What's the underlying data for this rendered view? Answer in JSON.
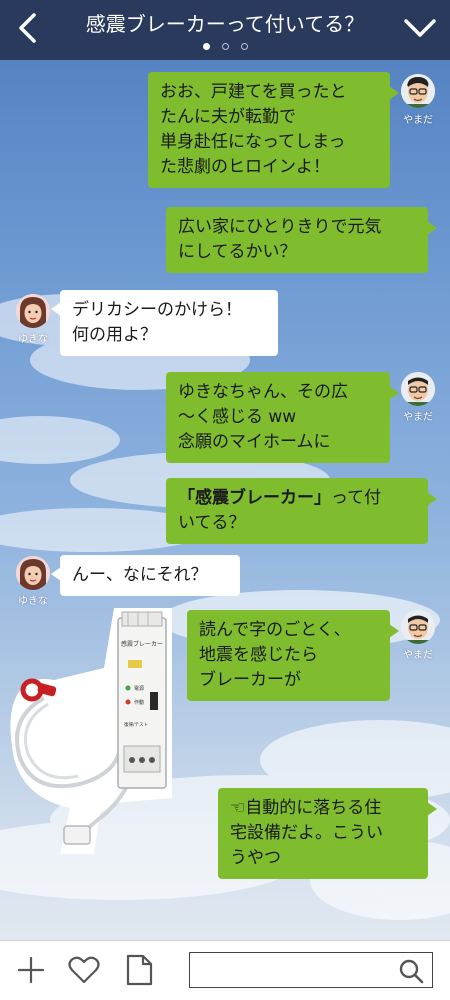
{
  "header": {
    "title": "感震ブレーカーって付いてる？",
    "page_dots": 3,
    "active_dot": 1
  },
  "users": {
    "yamada": {
      "name": "やまだ"
    },
    "yukina": {
      "name": "ゆきな"
    }
  },
  "messages": [
    {
      "from": "yamada",
      "side": "right",
      "lines": [
        "おお、戸建てを買ったと",
        "たんに夫が転勤で",
        "単身赴任になってしまっ",
        "た悲劇のヒロインよ！"
      ]
    },
    {
      "from": "yamada",
      "side": "right",
      "lines": [
        "広い家にひとりきりで元気",
        "にしてるかい？"
      ]
    },
    {
      "from": "yukina",
      "side": "left",
      "lines": [
        "デリカシーのかけら！",
        "何の用よ？"
      ]
    },
    {
      "from": "yamada",
      "side": "right",
      "lines": [
        "ゆきなちゃん、その広",
        "～く感じる ww",
        "念願のマイホームに"
      ]
    },
    {
      "from": "yamada",
      "side": "right",
      "bold": "「感震ブレーカー」",
      "after": "って付",
      "line2": "いてる？"
    },
    {
      "from": "yukina",
      "side": "left",
      "lines": [
        "んー、なにそれ？"
      ]
    },
    {
      "from": "yamada",
      "side": "right",
      "lines": [
        "読んで字のごとく、",
        "地震を感じたら",
        "ブレーカーが"
      ]
    },
    {
      "from": "yamada",
      "side": "right",
      "lines": [
        "☜自動的に落ちる住",
        "宅設備だよ。こうい",
        "うやつ"
      ]
    }
  ],
  "device_labels": {
    "name": "感震ブレーカー",
    "power": "電源",
    "operate": "作動",
    "test": "復帰/テスト"
  },
  "colors": {
    "header_bg": "#2a3a5c",
    "bubble_green": "#7fbd2f",
    "bubble_white": "#ffffff"
  },
  "footer": {
    "icons": [
      "plus-icon",
      "heart-icon",
      "document-icon",
      "search-icon"
    ],
    "search_placeholder": ""
  }
}
